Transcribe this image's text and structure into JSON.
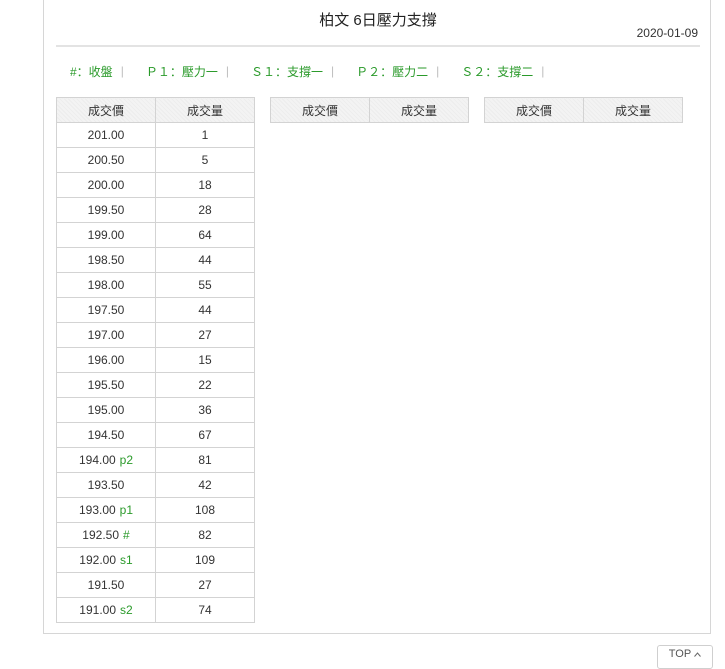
{
  "page": {
    "title": "柏文 6日壓力支撐",
    "date": "2020-01-09"
  },
  "legend": {
    "items": [
      "#：收盤",
      "Ｐ１：壓力一",
      "Ｓ１：支撐一",
      "Ｐ２：壓力二",
      "Ｓ２：支撐二"
    ],
    "separator": "|"
  },
  "tables": [
    {
      "headers": [
        "成交價",
        "成交量"
      ],
      "rows": [
        {
          "price": "201.00",
          "tag": "",
          "volume": "1"
        },
        {
          "price": "200.50",
          "tag": "",
          "volume": "5"
        },
        {
          "price": "200.00",
          "tag": "",
          "volume": "18"
        },
        {
          "price": "199.50",
          "tag": "",
          "volume": "28"
        },
        {
          "price": "199.00",
          "tag": "",
          "volume": "64"
        },
        {
          "price": "198.50",
          "tag": "",
          "volume": "44"
        },
        {
          "price": "198.00",
          "tag": "",
          "volume": "55"
        },
        {
          "price": "197.50",
          "tag": "",
          "volume": "44"
        },
        {
          "price": "197.00",
          "tag": "",
          "volume": "27"
        },
        {
          "price": "196.00",
          "tag": "",
          "volume": "15"
        },
        {
          "price": "195.50",
          "tag": "",
          "volume": "22"
        },
        {
          "price": "195.00",
          "tag": "",
          "volume": "36"
        },
        {
          "price": "194.50",
          "tag": "",
          "volume": "67"
        },
        {
          "price": "194.00",
          "tag": "p2",
          "volume": "81"
        },
        {
          "price": "193.50",
          "tag": "",
          "volume": "42"
        },
        {
          "price": "193.00",
          "tag": "p1",
          "volume": "108"
        },
        {
          "price": "192.50",
          "tag": "#",
          "volume": "82"
        },
        {
          "price": "192.00",
          "tag": "s1",
          "volume": "109"
        },
        {
          "price": "191.50",
          "tag": "",
          "volume": "27"
        },
        {
          "price": "191.00",
          "tag": "s2",
          "volume": "74"
        }
      ]
    },
    {
      "headers": [
        "成交價",
        "成交量"
      ],
      "rows": []
    },
    {
      "headers": [
        "成交價",
        "成交量"
      ],
      "rows": []
    }
  ],
  "footer": {
    "top_label": "TOP",
    "top_icon": "chevron-up-icon"
  }
}
